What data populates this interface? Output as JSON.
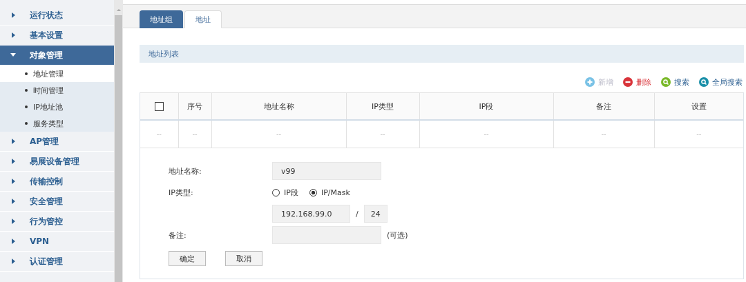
{
  "sidebar": {
    "items": [
      {
        "label": "运行状态",
        "expanded": false,
        "selected": false
      },
      {
        "label": "基本设置",
        "expanded": false,
        "selected": false
      },
      {
        "label": "对象管理",
        "expanded": true,
        "selected": true,
        "children": [
          {
            "label": "地址管理",
            "selected": true
          },
          {
            "label": "时间管理",
            "selected": false
          },
          {
            "label": "IP地址池",
            "selected": false
          },
          {
            "label": "服务类型",
            "selected": false
          }
        ]
      },
      {
        "label": "AP管理",
        "expanded": false,
        "selected": false
      },
      {
        "label": "易展设备管理",
        "expanded": false,
        "selected": false
      },
      {
        "label": "传输控制",
        "expanded": false,
        "selected": false
      },
      {
        "label": "安全管理",
        "expanded": false,
        "selected": false
      },
      {
        "label": "行为管控",
        "expanded": false,
        "selected": false
      },
      {
        "label": "VPN",
        "expanded": false,
        "selected": false
      },
      {
        "label": "认证管理",
        "expanded": false,
        "selected": false
      }
    ]
  },
  "tabs": [
    {
      "label": "地址组",
      "selected": false
    },
    {
      "label": "地址",
      "selected": true
    }
  ],
  "section_title": "地址列表",
  "toolbar": [
    {
      "kind": "add",
      "label": "新增",
      "disabled": true
    },
    {
      "kind": "delete",
      "label": "删除",
      "disabled": false
    },
    {
      "kind": "search",
      "label": "搜索",
      "disabled": false
    },
    {
      "kind": "global_search",
      "label": "全局搜索",
      "disabled": false
    }
  ],
  "table": {
    "columns": [
      {
        "kind": "checkbox",
        "checked": false
      },
      {
        "kind": "text",
        "label": "序号"
      },
      {
        "kind": "text",
        "label": "地址名称"
      },
      {
        "kind": "text",
        "label": "IP类型"
      },
      {
        "kind": "text",
        "label": "IP段"
      },
      {
        "kind": "text",
        "label": "备注"
      },
      {
        "kind": "text",
        "label": "设置"
      }
    ],
    "rows": [
      {
        "cells": [
          "--",
          "--",
          "--",
          "--",
          "--",
          "--",
          "--"
        ]
      }
    ]
  },
  "form": {
    "name_label": "地址名称:",
    "name_value": "v99",
    "type_label": "IP类型:",
    "type_options": [
      {
        "label": "IP段",
        "selected": false
      },
      {
        "label": "IP/Mask",
        "selected": true
      }
    ],
    "ip_value": "192.168.99.0",
    "slash": "/",
    "mask_value": "24",
    "note_label": "备注:",
    "note_hint": "(可选)",
    "buttons": [
      "确定",
      "取消"
    ]
  }
}
